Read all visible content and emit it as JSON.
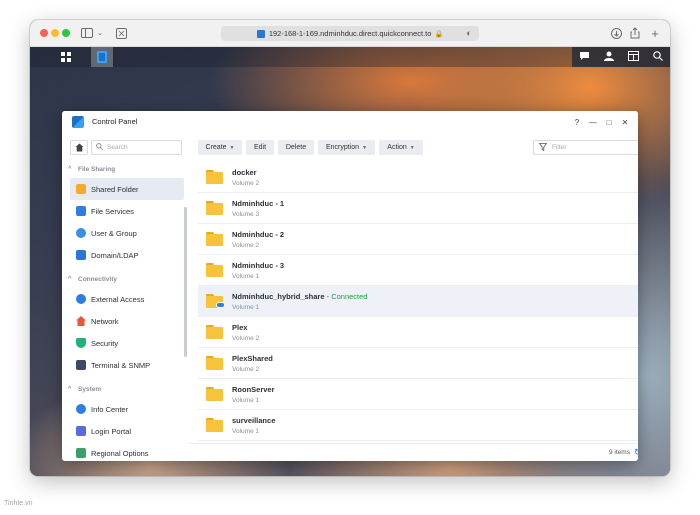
{
  "browser": {
    "url": "192-168-1-169.ndminhduc.direct.quickconnect.to"
  },
  "window": {
    "title": "Control Panel",
    "controls": [
      "?",
      "—",
      "□",
      "✕"
    ]
  },
  "sidebar": {
    "search_placeholder": "Search",
    "groups": [
      {
        "label": "File Sharing",
        "items": [
          {
            "label": "Shared Folder",
            "icon": "shared-folder-icon",
            "active": true
          },
          {
            "label": "File Services",
            "icon": "file-services-icon"
          },
          {
            "label": "User & Group",
            "icon": "user-group-icon"
          },
          {
            "label": "Domain/LDAP",
            "icon": "domain-ldap-icon"
          }
        ]
      },
      {
        "label": "Connectivity",
        "items": [
          {
            "label": "External Access",
            "icon": "external-access-icon"
          },
          {
            "label": "Network",
            "icon": "network-icon"
          },
          {
            "label": "Security",
            "icon": "security-icon"
          },
          {
            "label": "Terminal & SNMP",
            "icon": "terminal-icon"
          }
        ]
      },
      {
        "label": "System",
        "items": [
          {
            "label": "Info Center",
            "icon": "info-center-icon"
          },
          {
            "label": "Login Portal",
            "icon": "login-portal-icon"
          },
          {
            "label": "Regional Options",
            "icon": "regional-options-icon"
          }
        ]
      }
    ]
  },
  "toolbar": {
    "create": "Create",
    "edit": "Edit",
    "delete": "Delete",
    "encryption": "Encryption",
    "action": "Action",
    "filter_placeholder": "Filter"
  },
  "folders": [
    {
      "name": "docker",
      "volume": "Volume 2"
    },
    {
      "name": "Ndminhduc - 1",
      "volume": "Volume 3"
    },
    {
      "name": "Ndminhduc - 2",
      "volume": "Volume 2"
    },
    {
      "name": "Ndminhduc - 3",
      "volume": "Volume 1"
    },
    {
      "name": "Ndminhduc_hybrid_share",
      "volume": "Volume 1",
      "status": "Connected",
      "selected": true
    },
    {
      "name": "Plex",
      "volume": "Volume 2"
    },
    {
      "name": "PlexShared",
      "volume": "Volume 2"
    },
    {
      "name": "RoonServer",
      "volume": "Volume 1"
    },
    {
      "name": "surveillance",
      "volume": "Volume 1"
    }
  ],
  "footer": {
    "count": "9 items"
  },
  "watermark": "Tinhte.vn",
  "colors": {
    "accent": "#2f7de0",
    "connected": "#1e9e3e",
    "folder": "#f7c33b"
  }
}
